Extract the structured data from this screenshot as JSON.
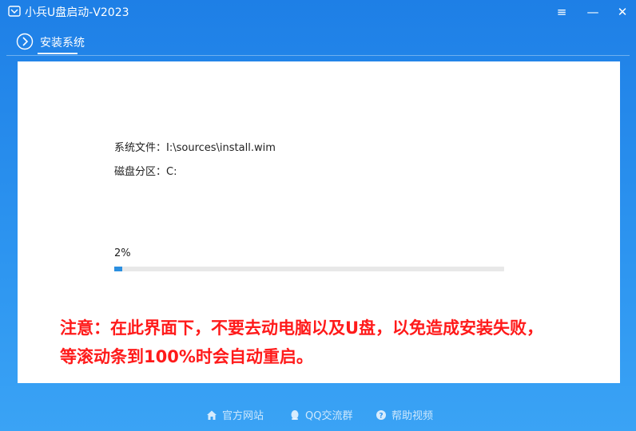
{
  "window": {
    "title": "小兵U盘启动-V2023",
    "menu_glyph": "≡",
    "minimize_glyph": "—",
    "close_glyph": "✕"
  },
  "tab": {
    "label": "安装系统"
  },
  "install": {
    "file_label": "系统文件：",
    "file_value": "I:\\sources\\install.wim",
    "disk_label": "磁盘分区：",
    "disk_value": "C:",
    "progress_text": "2%",
    "progress_fraction": 0.02
  },
  "warning": {
    "line1": "注意：在此界面下，不要去动电脑以及U盘，以免造成安装失败，",
    "line2": "等滚动条到100%时会自动重启。"
  },
  "footer": {
    "links": [
      {
        "label": "官方网站",
        "icon": "home-icon"
      },
      {
        "label": "QQ交流群",
        "icon": "qq-icon"
      },
      {
        "label": "帮助视频",
        "icon": "help-icon"
      }
    ]
  },
  "colors": {
    "background": "#2d95f0",
    "progress": "#2b8fe0",
    "warning": "#ff1a1a"
  }
}
